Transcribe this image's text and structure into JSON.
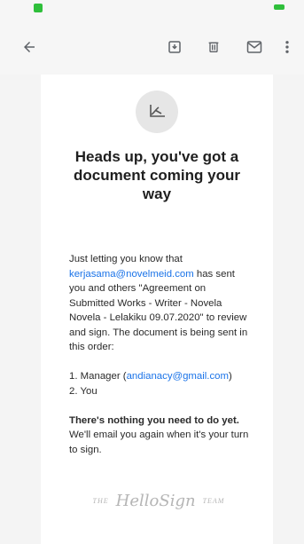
{
  "toolbar": {
    "back_icon": "arrow-left-icon",
    "archive_icon": "archive-icon",
    "delete_icon": "trash-icon",
    "mail_icon": "envelope-icon",
    "more_icon": "more-vert-icon"
  },
  "email": {
    "logo_icon": "signature-icon",
    "headline": "Heads up, you've got a document coming your way",
    "intro_prefix": "Just letting you know that ",
    "sender_email": "kerjasama@novelmeid.com",
    "intro_suffix": " has sent you and others \"Agreement on Submitted Works - Writer - Novela Novela - Lelakiku 09.07.2020\" to review and sign. The document is being sent in this order:",
    "order_1_prefix": "1. Manager (",
    "order_1_email": "andianacy@gmail.com",
    "order_1_suffix": ")",
    "order_2": "2. You",
    "nothing_bold": "There's nothing you need to do yet.",
    "nothing_rest": " We'll email you again when it's your turn to sign.",
    "signoff_the": "THE",
    "signoff_brand": "HelloSign",
    "signoff_team": "TEAM"
  },
  "colors": {
    "link": "#1a73e8",
    "status_green": "#2fbf3b"
  }
}
